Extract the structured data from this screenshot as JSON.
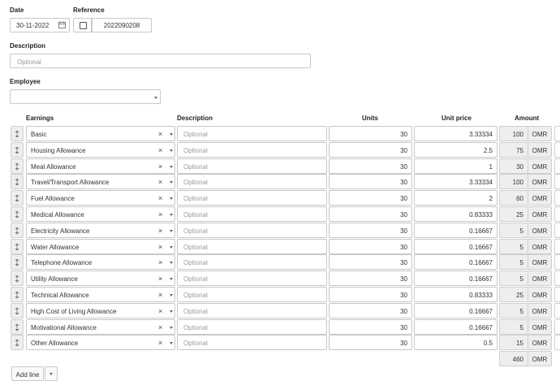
{
  "form": {
    "date_label": "Date",
    "date_value": "30-11-2022",
    "reference_label": "Reference",
    "reference_value": "2022090208",
    "description_label": "Description",
    "description_placeholder": "Optional",
    "employee_label": "Employee",
    "employee_value": ""
  },
  "table": {
    "headers": {
      "earnings": "Earnings",
      "description": "Description",
      "units": "Units",
      "unit_price": "Unit price",
      "amount": "Amount"
    },
    "rows": [
      {
        "earning": "Basic",
        "description": "Optional",
        "units": "30",
        "unit_price": "3.33334",
        "amount": "100",
        "currency": "OMR"
      },
      {
        "earning": "Housing Allowance",
        "description": "Optional",
        "units": "30",
        "unit_price": "2.5",
        "amount": "75",
        "currency": "OMR"
      },
      {
        "earning": "Meal Allowance",
        "description": "Optional",
        "units": "30",
        "unit_price": "1",
        "amount": "30",
        "currency": "OMR"
      },
      {
        "earning": "Travel/Transport Allowance",
        "description": "Optional",
        "units": "30",
        "unit_price": "3.33334",
        "amount": "100",
        "currency": "OMR"
      },
      {
        "earning": "Fuel Allowance",
        "description": "Optional",
        "units": "30",
        "unit_price": "2",
        "amount": "60",
        "currency": "OMR"
      },
      {
        "earning": "Medical Allowance",
        "description": "Optional",
        "units": "30",
        "unit_price": "0.83333",
        "amount": "25",
        "currency": "OMR"
      },
      {
        "earning": "Electricity Allowance",
        "description": "Optional",
        "units": "30",
        "unit_price": "0.16667",
        "amount": "5",
        "currency": "OMR"
      },
      {
        "earning": "Water Allowance",
        "description": "Optional",
        "units": "30",
        "unit_price": "0.16667",
        "amount": "5",
        "currency": "OMR"
      },
      {
        "earning": "Telephone Allowance",
        "description": "Optional",
        "units": "30",
        "unit_price": "0.16667",
        "amount": "5",
        "currency": "OMR"
      },
      {
        "earning": "Utility Allowance",
        "description": "Optional",
        "units": "30",
        "unit_price": "0.16667",
        "amount": "5",
        "currency": "OMR"
      },
      {
        "earning": "Technical Allowance",
        "description": "Optional",
        "units": "30",
        "unit_price": "0.83333",
        "amount": "25",
        "currency": "OMR"
      },
      {
        "earning": "High Cost of Living Allowance",
        "description": "Optional",
        "units": "30",
        "unit_price": "0.16667",
        "amount": "5",
        "currency": "OMR"
      },
      {
        "earning": "Motivational Allowance",
        "description": "Optional",
        "units": "30",
        "unit_price": "0.16667",
        "amount": "5",
        "currency": "OMR"
      },
      {
        "earning": "Other Allowance",
        "description": "Optional",
        "units": "30",
        "unit_price": "0.5",
        "amount": "15",
        "currency": "OMR"
      }
    ],
    "total_amount": "460",
    "total_currency": "OMR"
  },
  "footer": {
    "add_line_label": "Add line"
  }
}
